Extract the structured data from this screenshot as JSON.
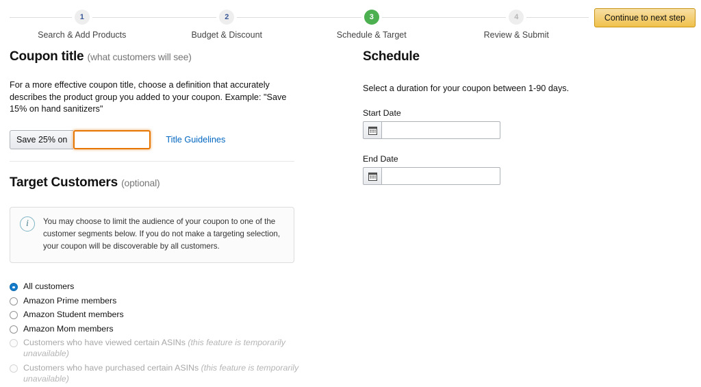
{
  "stepper": {
    "steps": [
      {
        "number": "1",
        "label": "Search & Add Products",
        "state": "done"
      },
      {
        "number": "2",
        "label": "Budget & Discount",
        "state": "done"
      },
      {
        "number": "3",
        "label": "Schedule & Target",
        "state": "active"
      },
      {
        "number": "4",
        "label": "Review & Submit",
        "state": "inactive"
      }
    ],
    "continue_button": "Continue to next step",
    "active_color": "#4caf50",
    "button_color": "#f0c14b"
  },
  "coupon_title": {
    "heading": "Coupon title",
    "heading_sub": "(what customers will see)",
    "help": "For a more effective coupon title, choose a definition that accurately describes the product group you added to your coupon. Example: \"Save 15% on hand sanitizers\"",
    "prefix": "Save 25% on",
    "input_value": "",
    "input_placeholder": "",
    "guidelines_link": "Title Guidelines",
    "focus_color": "#e77600",
    "link_color": "#0066c0"
  },
  "target_customers": {
    "heading": "Target Customers",
    "heading_sub": "(optional)",
    "info_icon": "info-icon",
    "info_text": "You may choose to limit the audience of your coupon to one of the customer segments below. If you do not make a targeting selection, your coupon will be discoverable by all customers.",
    "options": [
      {
        "label": "All customers",
        "note": "",
        "checked": true,
        "disabled": false
      },
      {
        "label": "Amazon Prime members",
        "note": "",
        "checked": false,
        "disabled": false
      },
      {
        "label": "Amazon Student members",
        "note": "",
        "checked": false,
        "disabled": false
      },
      {
        "label": "Amazon Mom members",
        "note": "",
        "checked": false,
        "disabled": false
      },
      {
        "label": "Customers who have viewed certain ASINs",
        "note": "(this feature is temporarily unavailable)",
        "checked": false,
        "disabled": true
      },
      {
        "label": "Customers who have purchased certain ASINs",
        "note": "(this feature is temporarily unavailable)",
        "checked": false,
        "disabled": true
      }
    ],
    "selected_color": "#137bc9"
  },
  "schedule": {
    "heading": "Schedule",
    "help": "Select a duration for your coupon between 1-90 days.",
    "start_date": {
      "label": "Start Date",
      "value": "",
      "placeholder": "",
      "icon": "calendar-icon"
    },
    "end_date": {
      "label": "End Date",
      "value": "",
      "placeholder": "",
      "icon": "calendar-icon"
    }
  }
}
